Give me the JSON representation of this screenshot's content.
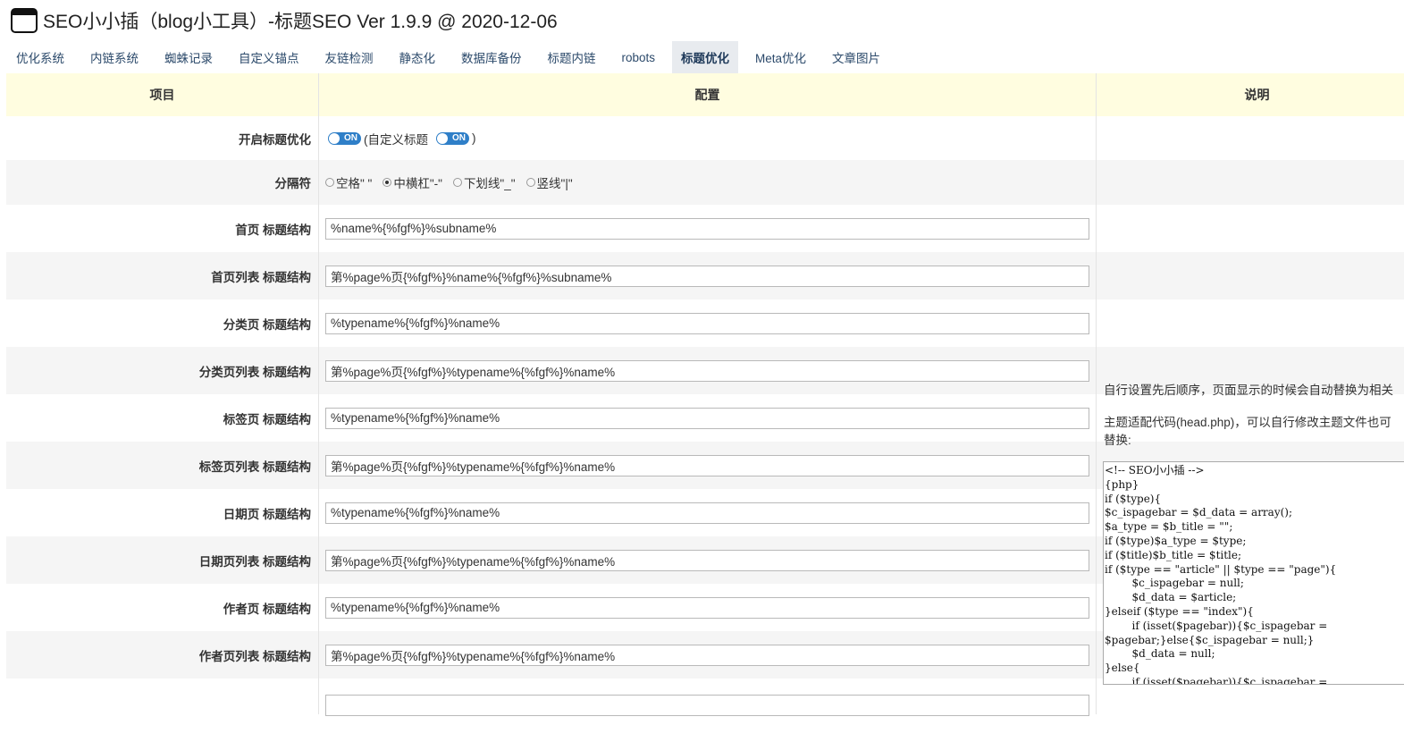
{
  "app": {
    "title": "SEO小小插（blog小工具）-标题SEO Ver 1.9.9 @ 2020-12-06"
  },
  "tabs": [
    {
      "label": "优化系统",
      "active": false
    },
    {
      "label": "内链系统",
      "active": false
    },
    {
      "label": "蜘蛛记录",
      "active": false
    },
    {
      "label": "自定义锚点",
      "active": false
    },
    {
      "label": "友链检测",
      "active": false
    },
    {
      "label": "静态化",
      "active": false
    },
    {
      "label": "数据库备份",
      "active": false
    },
    {
      "label": "标题内链",
      "active": false
    },
    {
      "label": "robots",
      "active": false
    },
    {
      "label": "标题优化",
      "active": true
    },
    {
      "label": "Meta优化",
      "active": false
    },
    {
      "label": "文章图片",
      "active": false
    }
  ],
  "table": {
    "headers": {
      "item": "项目",
      "config": "配置",
      "desc": "说明"
    }
  },
  "toggle_row": {
    "label": "开启标题优化",
    "toggle_on_text": "ON",
    "paren_open": "(自定义标题",
    "paren_close": ")"
  },
  "separator_row": {
    "label": "分隔符",
    "options": [
      {
        "label": "空格\" \"",
        "selected": false
      },
      {
        "label": "中横杠\"-\"",
        "selected": true
      },
      {
        "label": "下划线\"_\"",
        "selected": false
      },
      {
        "label": "竖线\"|\"",
        "selected": false
      }
    ]
  },
  "fields": [
    {
      "label": "首页 标题结构",
      "value": "%name%{%fgf%}%subname%"
    },
    {
      "label": "首页列表 标题结构",
      "value": "第%page%页{%fgf%}%name%{%fgf%}%subname%"
    },
    {
      "label": "分类页 标题结构",
      "value": "%typename%{%fgf%}%name%"
    },
    {
      "label": "分类页列表 标题结构",
      "value": "第%page%页{%fgf%}%typename%{%fgf%}%name%"
    },
    {
      "label": "标签页 标题结构",
      "value": "%typename%{%fgf%}%name%"
    },
    {
      "label": "标签页列表 标题结构",
      "value": "第%page%页{%fgf%}%typename%{%fgf%}%name%"
    },
    {
      "label": "日期页 标题结构",
      "value": "%typename%{%fgf%}%name%"
    },
    {
      "label": "日期页列表 标题结构",
      "value": "第%page%页{%fgf%}%typename%{%fgf%}%name%"
    },
    {
      "label": "作者页 标题结构",
      "value": "%typename%{%fgf%}%name%"
    },
    {
      "label": "作者页列表 标题结构",
      "value": "第%page%页{%fgf%}%typename%{%fgf%}%name%"
    }
  ],
  "description": {
    "line1": "自行设置先后顺序，页面显示的时候会自动替换为相关",
    "line2": "主题适配代码(head.php)，可以自行修改主题文件也可",
    "line3": "替换:",
    "code": "<!-- SEO小小插 -->\n{php}\nif ($type){\n$c_ispagebar = $d_data = array();\n$a_type = $b_title = \"\";\nif ($type)$a_type = $type;\nif ($title)$b_title = $title;\nif ($type == \"article\" || $type == \"page\"){\n        $c_ispagebar = null;\n        $d_data = $article;\n}elseif ($type == \"index\"){\n        if (isset($pagebar)){$c_ispagebar =\n$pagebar;}else{$c_ispagebar = null;}\n        $d_data = null;\n}else{\n        if (isset($pagebar)){$c_ispagebar ="
  }
}
